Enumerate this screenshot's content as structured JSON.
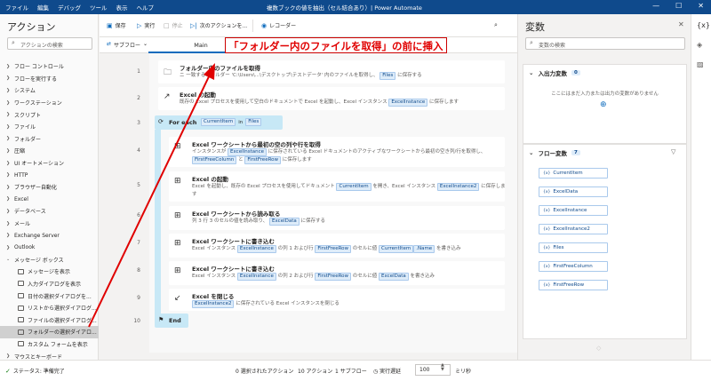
{
  "window": {
    "menu": [
      "ファイル",
      "編集",
      "デバッグ",
      "ツール",
      "表示",
      "ヘルプ"
    ],
    "title": "複数ブックの値を抽出（セル結合あり）| Power Automate",
    "controls": [
      "—",
      "☐",
      "✕"
    ]
  },
  "actions_panel": {
    "title": "アクション",
    "search_placeholder": "アクションの検索",
    "categories": [
      "フロー コントロール",
      "フローを実行する",
      "システム",
      "ワークステーション",
      "スクリプト",
      "ファイル",
      "フォルダー",
      "圧縮",
      "UI オートメーション",
      "HTTP",
      "ブラウザー自動化",
      "Excel",
      "データベース",
      "メール",
      "Exchange Server",
      "Outlook"
    ],
    "expanded_category": "メッセージ ボックス",
    "subitems": [
      "メッセージを表示",
      "入力ダイアログを表示",
      "日付の選択ダイアログを...",
      "リストから選択ダイアログ...",
      "ファイルの選択ダイアログ...",
      "フォルダーの選択ダイアロ...",
      "カスタム フォームを表示"
    ],
    "selected_subitem": "フォルダーの選択ダイアロ...",
    "last_category": "マウスとキーボード"
  },
  "toolbar": {
    "save": "保存",
    "run": "実行",
    "stop": "停止",
    "next": "次のアクションを...",
    "recorder": "レコーダー"
  },
  "tabs": {
    "subflow": "サブフロー",
    "main": "Main"
  },
  "flow": {
    "line_numbers": [
      "1",
      "2",
      "3",
      "4",
      "5",
      "6",
      "7",
      "8",
      "9",
      "10"
    ],
    "step1": {
      "title": "フォルダー内のファイルを取得",
      "desc_pre": "ニ 一致するフォルダー 'C:\\Users\\...\\デスクトップ\\テストデータ' 内のファイルを取得し、",
      "var": "Files",
      "desc_post": "に保存する"
    },
    "step2": {
      "title": "Excel の起動",
      "desc_pre": "既存の Excel プロセスを使用して空白のドキュメントで Excel を起動し、Excel インスタンス",
      "var": "ExcelInstance",
      "desc_post": "に保存します"
    },
    "foreach": {
      "title": "For each",
      "item": "CurrentItem",
      "in": "in",
      "list": "Files"
    },
    "step4": {
      "title": "Excel ワークシートから最初の空の列や行を取得",
      "l1_pre": "インスタンスが",
      "l1_var": "ExcelInstance",
      "l1_post": "に保存されている Excel ドキュメントのアクティブなワークシートから最初の空き列/行を取得し、",
      "l2_var1": "FirstFreeColumn",
      "l2_and": "と",
      "l2_var2": "FirstFreeRow",
      "l2_post": "に保存します"
    },
    "step5": {
      "title": "Excel の起動",
      "l1_pre": "Excel を起動し、既存の Excel プロセスを使用してドキュメント",
      "l1_var1": "CurrentItem",
      "l1_mid": "を開き、Excel インスタンス",
      "l1_var2": "ExcelInstance2",
      "l1_post": "に保存しま",
      "l2": "す"
    },
    "step6": {
      "title": "Excel ワークシートから読み取る",
      "desc_pre": "列 3 行 3 のセルの値を読み取り、",
      "var": "ExcelData",
      "desc_post": "に保存する"
    },
    "step7": {
      "title": "Excel ワークシートに書き込む",
      "d1": "Excel インスタンス",
      "v1": "ExcelInstance",
      "d2": "の列 1 および行",
      "v2": "FirstFreeRow",
      "d3": "のセルに値",
      "v3": "CurrentItem",
      "v4": ".Name",
      "d4": "を書き込み"
    },
    "step8": {
      "title": "Excel ワークシートに書き込む",
      "d1": "Excel インスタンス",
      "v1": "ExcelInstance",
      "d2": "の列 2 および行",
      "v2": "FirstFreeRow",
      "d3": "のセルに値",
      "v3": "ExcelData",
      "d4": "を書き込み"
    },
    "step9": {
      "title": "Excel を閉じる",
      "var": "ExcelInstance2",
      "desc_post": "に保存されている Excel インスタンスを閉じる"
    },
    "end": "End"
  },
  "annotation": {
    "text": "「フォルダー内のファイルを取得」の前に挿入",
    "color": "#e00000"
  },
  "variables_panel": {
    "title": "変数",
    "search_placeholder": "変数の検索",
    "io_title": "入出力変数",
    "io_count": "0",
    "io_empty": "ここにはまだ入力または出力の変数がありません",
    "flow_title": "フロー変数",
    "flow_count": "7",
    "flow_vars": [
      "CurrentItem",
      "ExcelData",
      "ExcelInstance",
      "ExcelInstance2",
      "Files",
      "FirstFreeColumn",
      "FirstFreeRow"
    ]
  },
  "status": {
    "state": "ステータス: 準備完了",
    "selected": "0 選択されたアクション",
    "actions": "10 アクション",
    "subflows": "1 サブフロー",
    "delay_label": "実行遅延",
    "delay_value": "100",
    "unit": "ミリ秒"
  },
  "colors": {
    "titlebar": "#0f4a8c",
    "accent": "#0f6cbd",
    "loop_block": "#c7e8f6",
    "chip": "#deecf9"
  }
}
